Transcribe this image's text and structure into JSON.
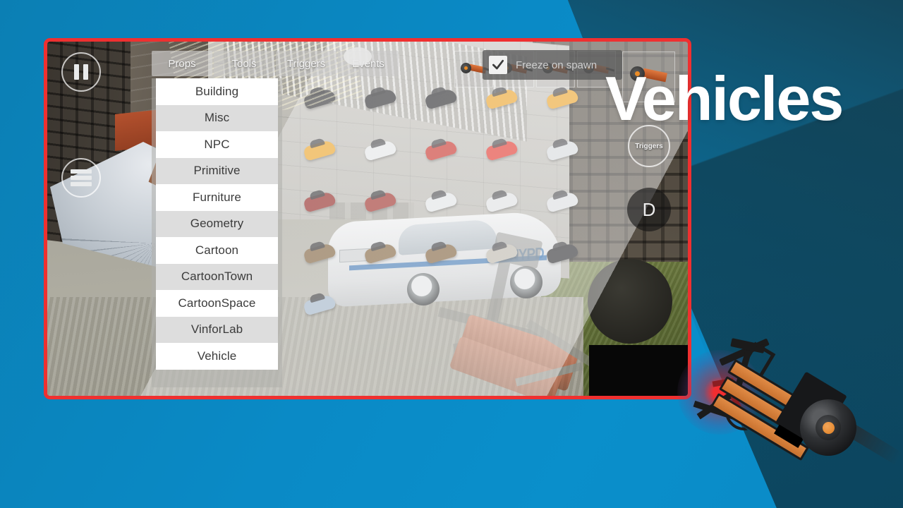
{
  "page": {
    "headline": "Vehicles",
    "accent_red": "#ef3030",
    "background_blue": "#0a8ac6",
    "background_dark_blue": "#113c4e"
  },
  "hud": {
    "pause_button": {
      "name": "pause",
      "label": ""
    },
    "menu_button": {
      "name": "menu",
      "label": ""
    },
    "triggers_button": {
      "label": "Triggers"
    },
    "drive_button": {
      "label": "D"
    }
  },
  "tabs": [
    {
      "label": "Props",
      "active": true
    },
    {
      "label": "Tools",
      "active": false
    },
    {
      "label": "Triggers",
      "active": false
    },
    {
      "label": "Events",
      "active": false
    }
  ],
  "categories": [
    {
      "label": "Building"
    },
    {
      "label": "Misc"
    },
    {
      "label": "NPC"
    },
    {
      "label": "Primitive"
    },
    {
      "label": "Furniture"
    },
    {
      "label": "Geometry"
    },
    {
      "label": "Cartoon"
    },
    {
      "label": "CartoonTown"
    },
    {
      "label": "CartoonSpace"
    },
    {
      "label": "VinforLab"
    },
    {
      "label": "Vehicle"
    }
  ],
  "options": {
    "freeze_on_spawn": {
      "label": "Freeze on spawn",
      "checked": true
    }
  },
  "thumbnails": [
    {
      "name": "weapon-thumbnail-1"
    },
    {
      "name": "weapon-thumbnail-2"
    },
    {
      "name": "weapon-thumbnail-3"
    },
    {
      "name": "weapon-thumbnail-4"
    }
  ],
  "right_thumbnail": {
    "name": "weapon-thumbnail-right"
  },
  "vehicle_grid": {
    "columns": 5,
    "items": [
      {
        "color": "#2b2b2d",
        "style": "sedan"
      },
      {
        "color": "#232326",
        "style": "sedan"
      },
      {
        "color": "#1d1d20",
        "style": "sedan"
      },
      {
        "color": "#f0a21e",
        "style": "hatch"
      },
      {
        "color": "#f0a21e",
        "style": "hatch"
      },
      {
        "color": "#efa31f",
        "style": "hatch"
      },
      {
        "color": "#e9ebec",
        "style": "pickup"
      },
      {
        "color": "#c9251d",
        "style": "coupe"
      },
      {
        "color": "#e52a20",
        "style": "hatch"
      },
      {
        "color": "#d9dde0",
        "style": "hatch"
      },
      {
        "color": "#8e1c18",
        "style": "coupe"
      },
      {
        "color": "#9b231c",
        "style": "coupe"
      },
      {
        "color": "#e6e8ea",
        "style": "sedan"
      },
      {
        "color": "#e3e5e7",
        "style": "police"
      },
      {
        "color": "#dfe2e4",
        "style": "convertible"
      },
      {
        "color": "#7a5a32",
        "style": "suv"
      },
      {
        "color": "#7d5c33",
        "style": "suv"
      },
      {
        "color": "#795830",
        "style": "suv"
      },
      {
        "color": "#bdb8ac",
        "style": "van"
      },
      {
        "color": "#1c1c1f",
        "style": "suv"
      },
      {
        "color": "#9fb4c9",
        "style": "convertible"
      },
      {
        "color": "",
        "style": ""
      },
      {
        "color": "",
        "style": ""
      },
      {
        "color": "",
        "style": ""
      },
      {
        "color": "",
        "style": ""
      }
    ]
  }
}
